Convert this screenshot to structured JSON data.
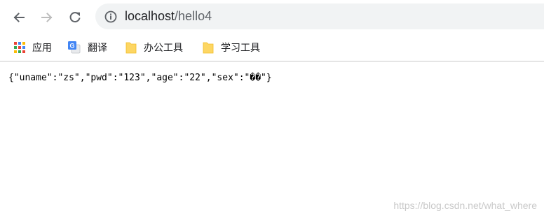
{
  "browser": {
    "url": {
      "host": "localhost",
      "path": "/hello4"
    },
    "bookmarks": [
      {
        "label": "应用",
        "icon": "apps-grid-icon"
      },
      {
        "label": "翻译",
        "icon": "google-translate-icon"
      },
      {
        "label": "办公工具",
        "icon": "folder-icon"
      },
      {
        "label": "学习工具",
        "icon": "folder-icon"
      }
    ]
  },
  "page": {
    "body_text": "{\"uname\":\"zs\",\"pwd\":\"123\",\"age\":\"22\",\"sex\":\"��\"}"
  },
  "watermark": "https://blog.csdn.net/what_where",
  "colors": {
    "omnibox_bg": "#f1f3f4",
    "folder_yellow": "#fdd663",
    "nav_icon": "#5f6368",
    "nav_icon_disabled": "#c0c0c0"
  }
}
